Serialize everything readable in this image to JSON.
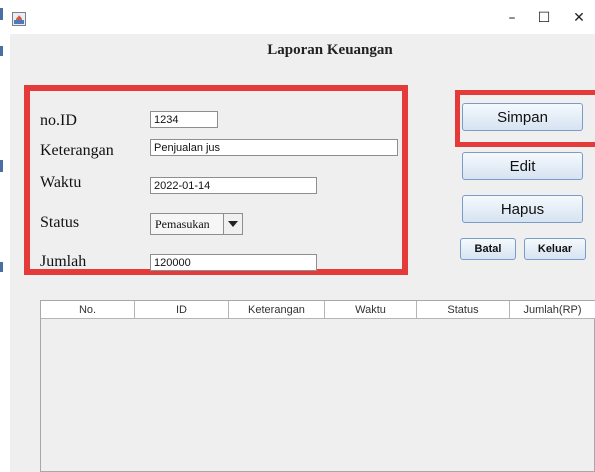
{
  "window": {
    "title": "Laporan Keuangan",
    "controls": {
      "minimize": "–",
      "maximize": "☐",
      "close": "✕"
    }
  },
  "form": {
    "fields": {
      "id": {
        "label": "no.ID",
        "value": "1234"
      },
      "keterangan": {
        "label": "Keterangan",
        "value": "Penjualan jus"
      },
      "waktu": {
        "label": "Waktu",
        "value": "2022-01-14"
      },
      "status": {
        "label": "Status",
        "value": "Pemasukan"
      },
      "jumlah": {
        "label": "Jumlah",
        "value": "120000"
      }
    }
  },
  "buttons": {
    "simpan": "Simpan",
    "edit": "Edit",
    "hapus": "Hapus",
    "batal": "Batal",
    "keluar": "Keluar"
  },
  "table": {
    "columns": [
      "No.",
      "ID",
      "Keterangan",
      "Waktu",
      "Status",
      "Jumlah(RP)"
    ],
    "rows": []
  },
  "colors": {
    "highlight": "#e53a3a",
    "window_bg": "#efefef",
    "button_border": "#7a9cc6"
  }
}
